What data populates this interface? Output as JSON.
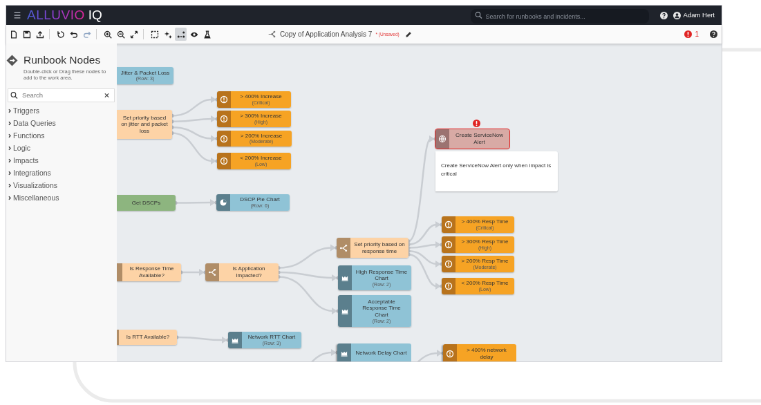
{
  "app": {
    "logo": {
      "brand": "ALLUVIO",
      "product": "IQ"
    },
    "search": {
      "placeholder": "Search for runbooks and incidents..."
    },
    "user": "Adam Hert"
  },
  "toolbar": {
    "groups": [
      [
        {
          "kind": "new",
          "disabled": false,
          "selected": false
        },
        {
          "kind": "save",
          "disabled": false,
          "selected": false
        },
        {
          "kind": "export",
          "disabled": false,
          "selected": false
        }
      ],
      [
        {
          "kind": "reset",
          "disabled": false,
          "selected": false
        },
        {
          "kind": "undo",
          "disabled": false,
          "selected": false
        },
        {
          "kind": "redo",
          "disabled": true,
          "selected": false
        }
      ],
      [
        {
          "kind": "zoom_in",
          "disabled": false,
          "selected": false
        },
        {
          "kind": "zoom_out",
          "disabled": false,
          "selected": false
        },
        {
          "kind": "fit",
          "disabled": false,
          "selected": false
        }
      ],
      [
        {
          "kind": "select",
          "disabled": false,
          "selected": false
        },
        {
          "kind": "add",
          "disabled": false,
          "selected": false
        },
        {
          "kind": "connect",
          "disabled": false,
          "selected": true
        },
        {
          "kind": "preview",
          "disabled": false,
          "selected": false
        },
        {
          "kind": "test",
          "disabled": false,
          "selected": false
        }
      ]
    ],
    "title": "Copy of Application Analysis 7",
    "unsaved": "* (Unsaved)",
    "error_count": "1"
  },
  "sidebar": {
    "title": "Runbook Nodes",
    "description": "Double-click or Drag these nodes to add to the work area.",
    "search": {
      "placeholder": "Search"
    },
    "categories": [
      {
        "label": "Triggers",
        "expanded": false
      },
      {
        "label": "Data Queries",
        "expanded": false
      },
      {
        "label": "Functions",
        "expanded": false
      },
      {
        "label": "Logic",
        "expanded": false
      },
      {
        "label": "Impacts",
        "expanded": false
      },
      {
        "label": "Integrations",
        "expanded": false
      },
      {
        "label": "Visualizations",
        "expanded": false
      },
      {
        "label": "Miscellaneous",
        "expanded": false
      }
    ]
  },
  "canvas": {
    "nodes": [
      {
        "kind": "chart",
        "title": "Jitter & Packet Loss",
        "subtitle": "(Row: 3)",
        "error": false,
        "incoming": false
      },
      {
        "kind": "logic",
        "title": "Set priority based on jitter and packet loss",
        "error": false,
        "incoming": false,
        "children": [
          {
            "kind": "impact",
            "title": "> 400% Increase",
            "subtitle": "(Critical)",
            "error": false,
            "incoming": false
          },
          {
            "kind": "impact",
            "title": "> 300% Increase",
            "subtitle": "(High)",
            "error": false,
            "incoming": false
          },
          {
            "kind": "impact",
            "title": "> 200% Increase",
            "subtitle": "(Moderate)",
            "error": false,
            "incoming": false
          },
          {
            "kind": "impact",
            "title": "< 200% Increase",
            "subtitle": "(Low)",
            "error": false,
            "incoming": false
          }
        ]
      },
      {
        "kind": "query",
        "title": "Get DSCPs",
        "error": false,
        "incoming": false,
        "children": [
          {
            "kind": "pie_chart",
            "title": "DSCP Pie Chart",
            "subtitle": "(Row: 6)",
            "error": false,
            "incoming": false
          }
        ]
      },
      {
        "kind": "logic",
        "title": "Is Response Time Available?",
        "error": false,
        "incoming": false,
        "children": [
          {
            "kind": "logic",
            "title": "Is Application Impacted?",
            "error": false,
            "incoming": false,
            "children": [
              {
                "kind": "logic",
                "title": "Set priority based on response time",
                "error": false,
                "incoming": false,
                "children": [
                  {
                    "kind": "integration",
                    "title": "Create ServiceNow Alert",
                    "error": true,
                    "incoming": false
                  },
                  {
                    "kind": "impact",
                    "title": "> 400% Resp Time",
                    "subtitle": "(Critical)",
                    "error": false,
                    "incoming": false
                  },
                  {
                    "kind": "impact",
                    "title": "> 300% Resp Time",
                    "subtitle": "(High)",
                    "error": false,
                    "incoming": false
                  },
                  {
                    "kind": "impact",
                    "title": "> 200% Resp Time",
                    "subtitle": "(Moderate)",
                    "error": false,
                    "incoming": false
                  },
                  {
                    "kind": "impact",
                    "title": "< 200% Resp Time",
                    "subtitle": "(Low)",
                    "error": false,
                    "incoming": false
                  }
                ]
              },
              {
                "kind": "chart",
                "title": "High Response Time Chart",
                "subtitle": "(Row: 2)",
                "error": false,
                "incoming": false
              },
              {
                "kind": "chart",
                "title": "Acceptable Response Time Chart",
                "subtitle": "(Row: 2)",
                "error": false,
                "incoming": false
              }
            ]
          }
        ]
      },
      {
        "kind": "logic",
        "title": "Is RTT Available?",
        "error": false,
        "incoming": false,
        "children": [
          {
            "kind": "chart",
            "title": "Network RTT Chart",
            "subtitle": "(Row: 3)",
            "error": false,
            "incoming": false
          }
        ]
      },
      {
        "kind": "chart",
        "title": "Network Delay Chart",
        "error": false,
        "incoming": true
      },
      {
        "kind": "impact",
        "title": "> 400% network delay",
        "error": false,
        "incoming": true
      }
    ],
    "note": {
      "text": "Create ServiceNow Alert only when impact is critical"
    }
  }
}
